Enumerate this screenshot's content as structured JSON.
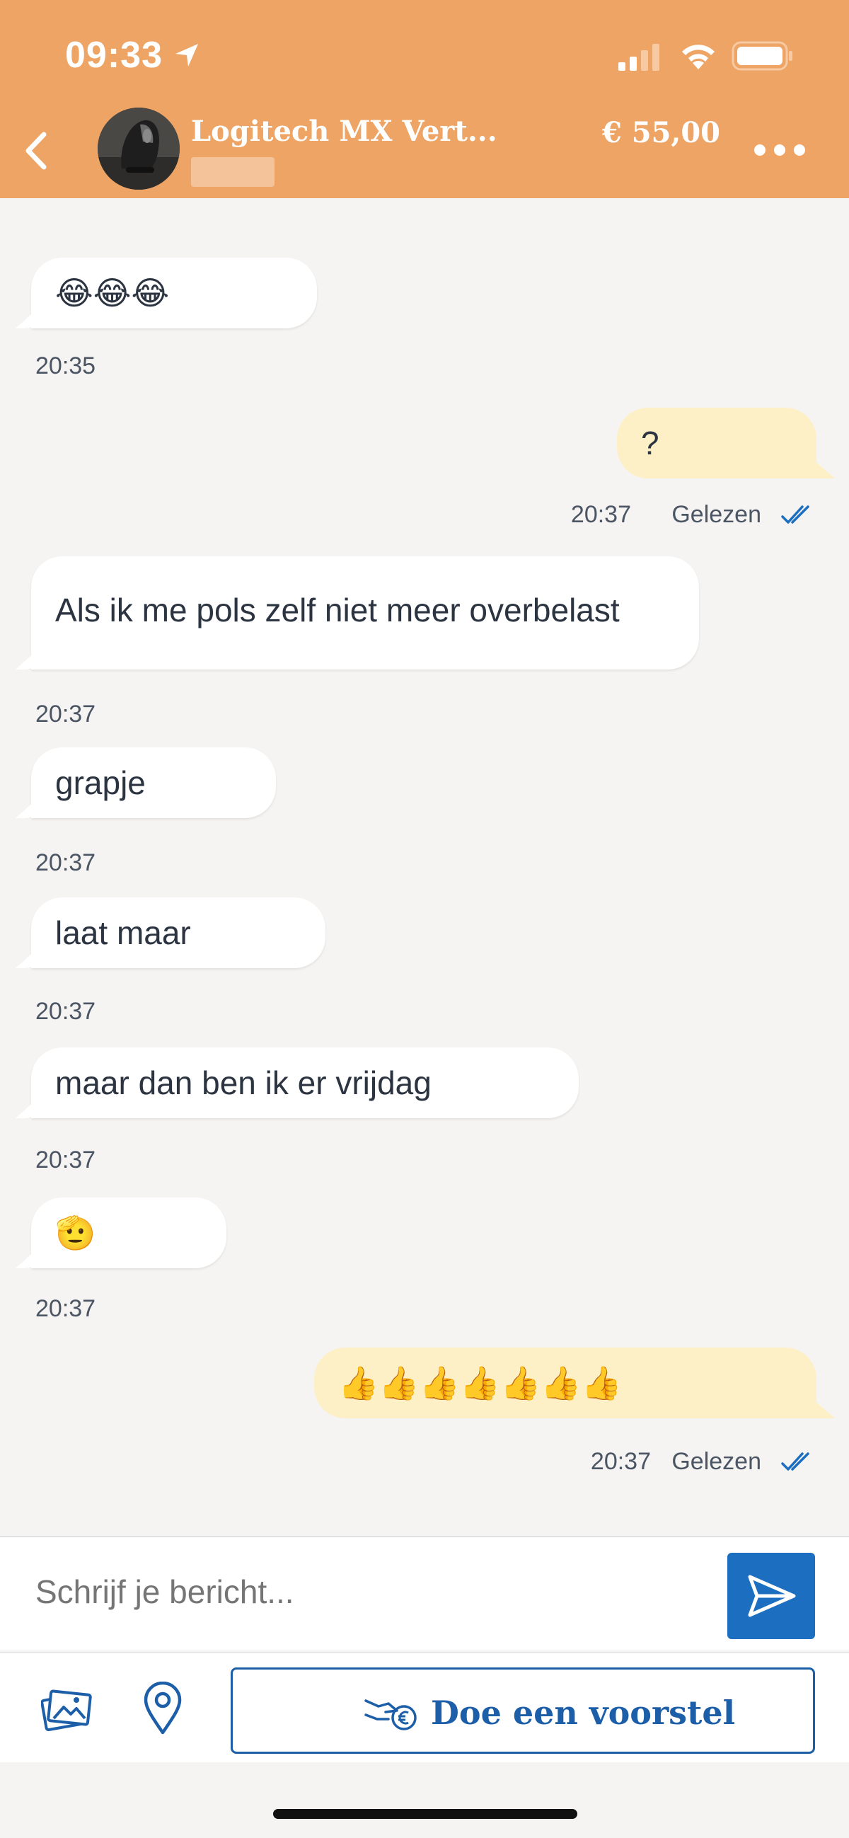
{
  "status_bar": {
    "time": "09:33"
  },
  "header": {
    "title": "Logitech MX Vert...",
    "price": "€ 55,00"
  },
  "messages": [
    {
      "dir": "in",
      "text": "😂😂😂",
      "time": "20:35"
    },
    {
      "dir": "out",
      "text": "?",
      "time": "20:37",
      "status": "Gelezen"
    },
    {
      "dir": "in",
      "text": "Als ik me pols zelf niet meer overbelast",
      "time": "20:37"
    },
    {
      "dir": "in",
      "text": "grapje",
      "time": "20:37"
    },
    {
      "dir": "in",
      "text": "laat maar",
      "time": "20:37"
    },
    {
      "dir": "in",
      "text": "maar dan ben ik er vrijdag",
      "time": "20:37"
    },
    {
      "dir": "in",
      "text": "🫡",
      "time": "20:37"
    },
    {
      "dir": "out",
      "text": "👍👍👍👍👍👍👍",
      "time": "20:37",
      "status": "Gelezen"
    }
  ],
  "composer": {
    "placeholder": "Schrijf je bericht..."
  },
  "toolbar": {
    "offer_label": "Doe een voorstel"
  },
  "colors": {
    "header": "#eda464",
    "accent": "#1c6fc0",
    "outgoing": "#fdf0c6"
  }
}
